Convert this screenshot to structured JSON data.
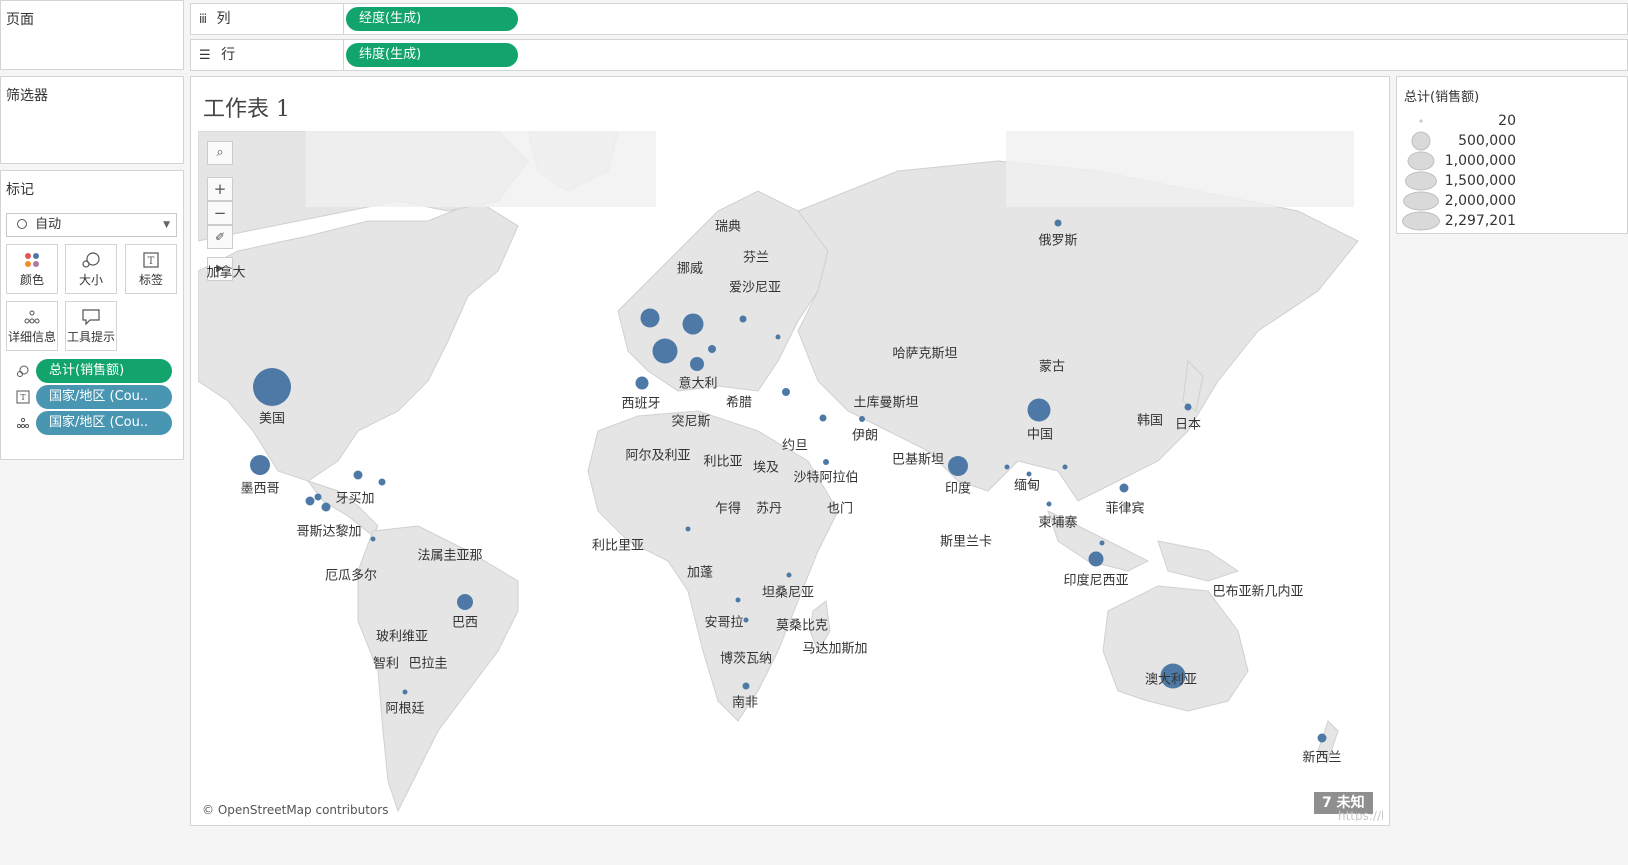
{
  "pages_panel": {
    "title": "页面"
  },
  "filters_panel": {
    "title": "筛选器"
  },
  "marks_panel": {
    "title": "标记",
    "mark_type": "自动",
    "buttons": [
      {
        "label": "颜色",
        "icon": "color-dots-icon"
      },
      {
        "label": "大小",
        "icon": "size-icon"
      },
      {
        "label": "标签",
        "icon": "label-icon"
      },
      {
        "label": "详细信息",
        "icon": "detail-icon"
      },
      {
        "label": "工具提示",
        "icon": "tooltip-icon"
      }
    ],
    "fields": [
      {
        "label": "总计(销售额)",
        "type": "size",
        "color": "#13a46d"
      },
      {
        "label": "国家/地区 (Cou..",
        "type": "label",
        "color": "#4996b2"
      },
      {
        "label": "国家/地区 (Cou..",
        "type": "detail",
        "color": "#4996b2"
      }
    ]
  },
  "shelves": {
    "columns": {
      "label": "列",
      "pill": "经度(生成)"
    },
    "rows": {
      "label": "行",
      "pill": "纬度(生成)"
    }
  },
  "worksheet": {
    "title": "工作表 1"
  },
  "map": {
    "attribution": "© OpenStreetMap contributors",
    "unknown_badge": "7 未知",
    "watermark": "https://blog.csdn.net/AvenueCyy",
    "tools": [
      "search-icon",
      "zoom-in-icon",
      "zoom-out-icon",
      "pin-icon",
      "expand-icon"
    ],
    "country_labels": [
      "加拿大",
      "瑞典",
      "挪威",
      "芬兰",
      "爱沙尼亚",
      "俄罗斯",
      "哈萨克斯坦",
      "蒙古",
      "美国",
      "西班牙",
      "意大利",
      "希腊",
      "突尼斯",
      "土库曼斯坦",
      "伊朗",
      "中国",
      "韩国",
      "日本",
      "阿尔及利亚",
      "利比亚",
      "埃及",
      "约旦",
      "沙特阿拉伯",
      "巴基斯坦",
      "印度",
      "缅甸",
      "菲律宾",
      "墨西哥",
      "牙买加",
      "哥斯达黎加",
      "乍得",
      "苏丹",
      "也门",
      "柬埔寨",
      "斯里兰卡",
      "利比里亚",
      "法属圭亚那",
      "厄瓜多尔",
      "加蓬",
      "印度尼西亚",
      "巴西",
      "坦桑尼亚",
      "巴布亚新几内亚",
      "安哥拉",
      "莫桑比克",
      "玻利维亚",
      "智利",
      "巴拉圭",
      "博茨瓦纳",
      "马达加斯加",
      "澳大利亚",
      "南非",
      "阿根廷",
      "新西兰"
    ]
  },
  "legend": {
    "title": "总计(销售额)",
    "values": [
      "20",
      "500,000",
      "1,000,000",
      "1,500,000",
      "2,000,000",
      "2,297,201"
    ]
  }
}
